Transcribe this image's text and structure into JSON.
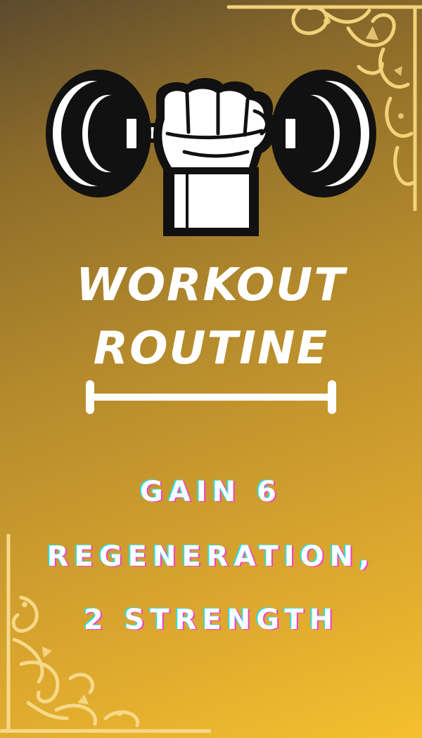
{
  "card": {
    "title_line_1": "WORKOUT",
    "title_line_2": "ROUTINE",
    "effect_lines": [
      "GAIN 6",
      "REGENERATION,",
      "2 STRENGTH"
    ],
    "icon": "dumbbell-fist-icon",
    "ornament_icon": "flourish-ornament-icon"
  },
  "colors": {
    "background_top": "#5c4a2e",
    "background_bottom": "#f5bf2f",
    "text": "#ffffff",
    "ornament": "#f2d27a",
    "shadow_cyan": "#29e0e6",
    "shadow_magenta": "#f23bd0"
  }
}
